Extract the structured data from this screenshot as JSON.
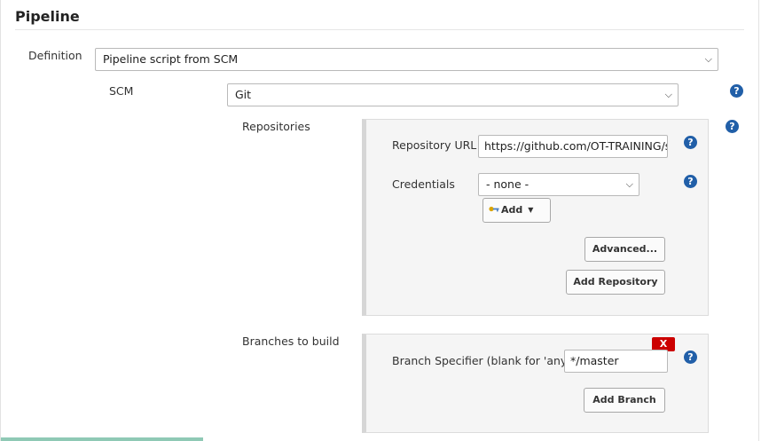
{
  "section": {
    "title": "Pipeline"
  },
  "definition": {
    "label": "Definition",
    "value": "Pipeline script from SCM"
  },
  "scm": {
    "label": "SCM",
    "value": "Git"
  },
  "repositories": {
    "label": "Repositories",
    "repository_url": {
      "label": "Repository URL",
      "value": "https://github.com/OT-TRAINING/sp"
    },
    "credentials": {
      "label": "Credentials",
      "value": "- none -"
    },
    "add_button": "Add",
    "advanced_button": "Advanced...",
    "add_repository_button": "Add Repository"
  },
  "branches": {
    "label": "Branches to build",
    "branch_specifier": {
      "label": "Branch Specifier (blank for 'any')",
      "value": "*/master"
    },
    "delete_button": "X",
    "add_branch_button": "Add Branch"
  },
  "help": {
    "glyph": "?"
  },
  "icons": {
    "help": "help-icon",
    "key": "key-icon",
    "dropdown": "chevron-down-icon"
  },
  "colors": {
    "help": "#215fa8",
    "delete": "#cc0000",
    "panel": "#f5f5f5"
  }
}
